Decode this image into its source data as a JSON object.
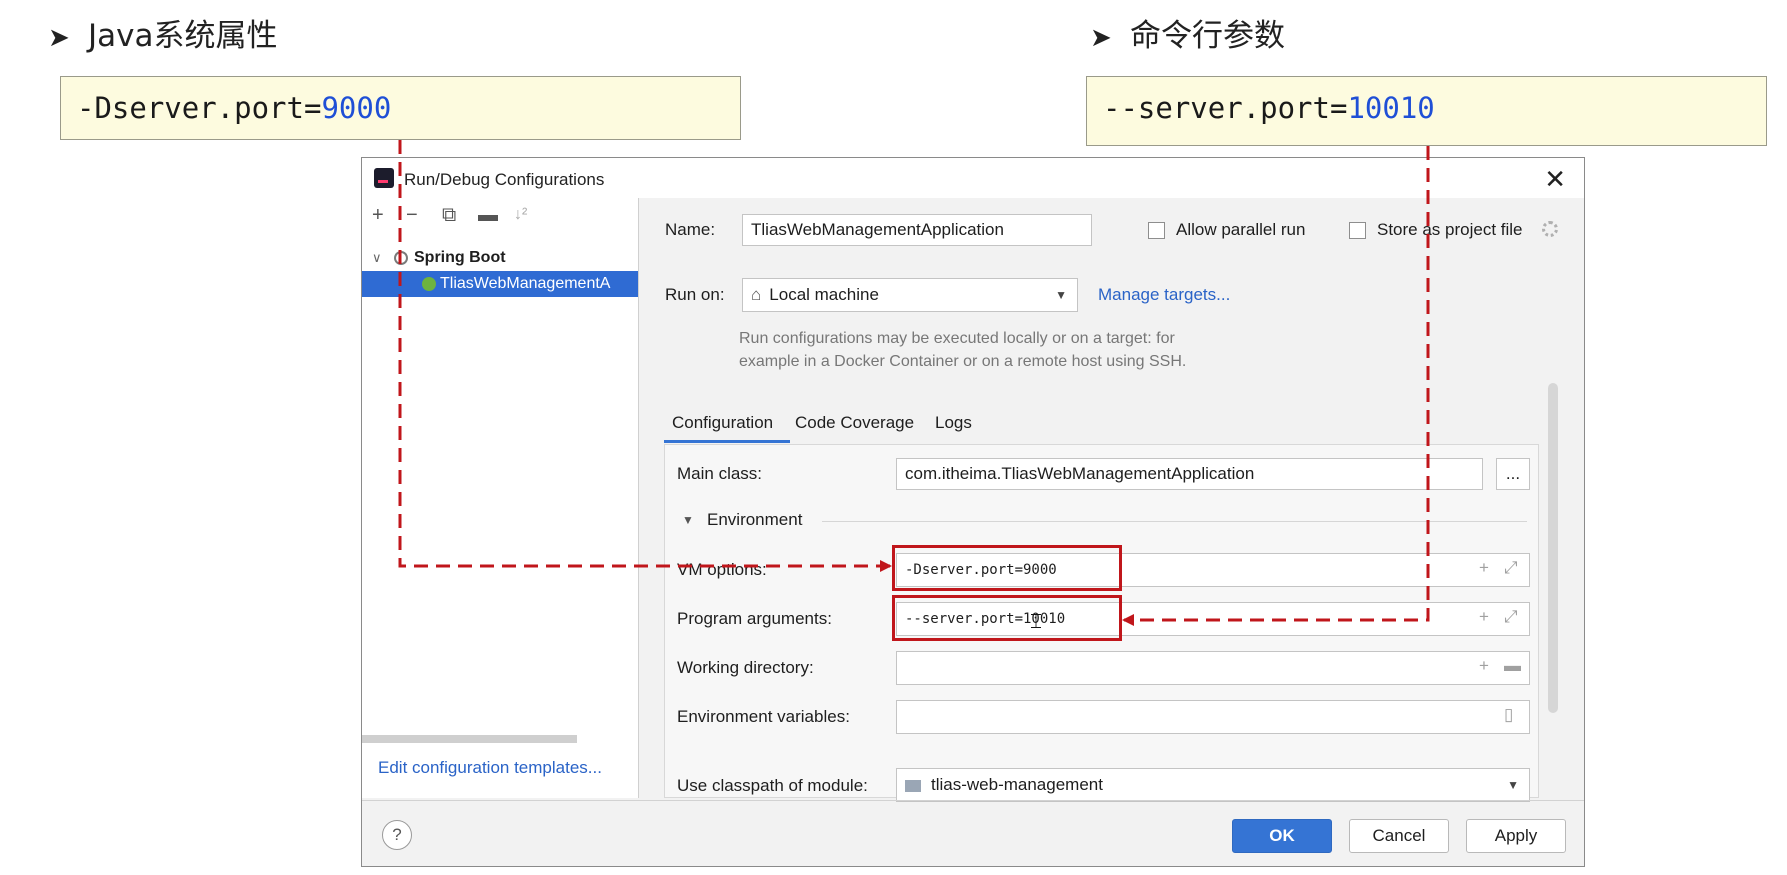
{
  "headings": {
    "left": "Java系统属性",
    "right": "命令行参数",
    "bullet": "➤"
  },
  "code_left": {
    "key": "-Dserver.port=",
    "value": "9000"
  },
  "code_right": {
    "key": "--server.port=",
    "value": "10010"
  },
  "dialog": {
    "title": "Run/Debug Configurations",
    "close": "✕",
    "toolbar": {
      "add": "+",
      "remove": "−",
      "copy": "⧉",
      "folder": "▬",
      "sort": "↓²"
    },
    "tree": {
      "group_toggle": "∨",
      "group": "Spring Boot",
      "item": "TliasWebManagementA"
    },
    "edit_templates": "Edit configuration templates...",
    "name_label": "Name:",
    "name_value": "TliasWebManagementApplication",
    "allow_parallel": "Allow parallel run",
    "store_project": "Store as project file",
    "run_on_label": "Run on:",
    "run_on_value": "Local machine",
    "run_on_arrow": "▼",
    "manage_targets": "Manage targets...",
    "hint_line1": "Run configurations may be executed locally or on a target: for",
    "hint_line2": "example in a Docker Container or on a remote host using SSH.",
    "tabs": [
      "Configuration",
      "Code Coverage",
      "Logs"
    ],
    "main_class_label": "Main class:",
    "main_class_value": "com.itheima.TliasWebManagementApplication",
    "browse": "...",
    "env_toggle": "▼",
    "environment": "Environment",
    "vm_label": "VM options:",
    "vm_value": "-Dserver.port=9000",
    "program_label": "Program arguments:",
    "program_value": "--server.port=10010",
    "workdir_label": "Working directory:",
    "envvars_label": "Environment variables:",
    "classpath_label": "Use classpath of module:",
    "classpath_value": "tlias-web-management",
    "classpath_arrow": "▼",
    "expand_icon": "⤢",
    "plus_icon": "+",
    "folder_icon": "▬",
    "doc_icon": "▯",
    "help": "?",
    "ok": "OK",
    "cancel": "Cancel",
    "apply": "Apply"
  },
  "colors": {
    "accent_red": "#c0161b",
    "selection_blue": "#2f6bd3",
    "code_blue": "#1f4fd6",
    "code_bg": "#fdfbdf"
  }
}
